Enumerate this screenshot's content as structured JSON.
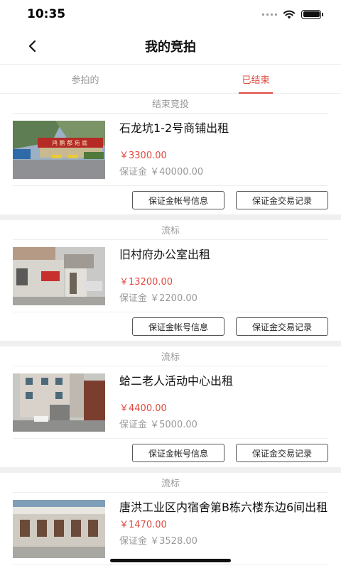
{
  "status_bar": {
    "time": "10:35"
  },
  "nav": {
    "title": "我的竞拍"
  },
  "tabs": [
    {
      "label": "参拍的",
      "active": false
    },
    {
      "label": "已结束",
      "active": true
    }
  ],
  "buttons": {
    "account_info": "保证金帐号信息",
    "transaction_log": "保证金交易记录"
  },
  "listings": [
    {
      "status": "结束竞投",
      "title": "石龙坑1-2号商铺出租",
      "price": "￥3300.00",
      "deposit": "保证金 ￥40000.00",
      "sign_text": "鸿 鹏 都 苑 庭"
    },
    {
      "status": "流标",
      "title": "旧村府办公室出租",
      "price": "￥13200.00",
      "deposit": "保证金 ￥2200.00"
    },
    {
      "status": "流标",
      "title": "蛤二老人活动中心出租",
      "price": "￥4400.00",
      "deposit": "保证金 ￥5000.00"
    },
    {
      "status": "流标",
      "title": "唐洪工业区内宿舍第B栋六楼东边6间出租",
      "price": "￥1470.00",
      "deposit": "保证金 ￥3528.00"
    }
  ],
  "colors": {
    "accent": "#e0493f",
    "muted": "#999999",
    "divider": "#f0f0f0"
  }
}
